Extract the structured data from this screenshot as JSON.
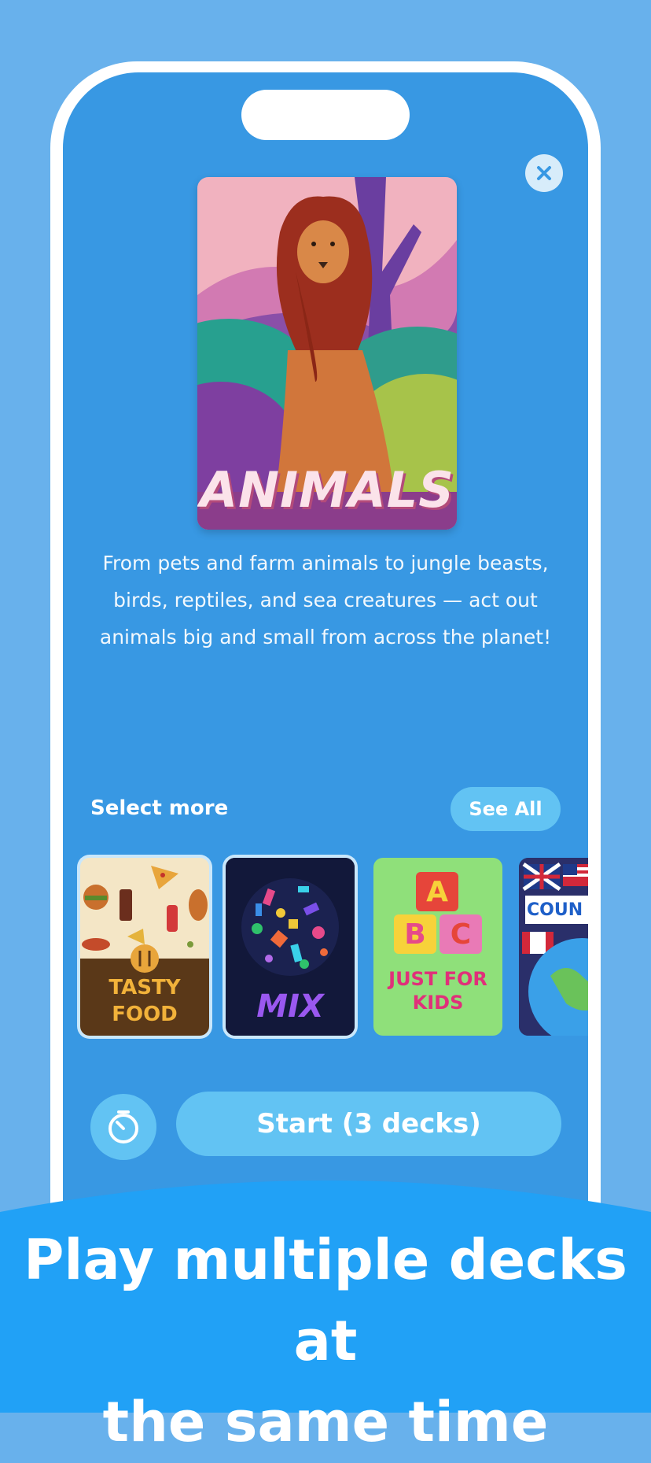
{
  "hero": {
    "deck_title": "ANIMALS",
    "description": "From pets and farm animals to jungle beasts, birds, reptiles, and sea creatures — act out animals big and small from across the planet!"
  },
  "select_more": {
    "label": "Select more",
    "see_all": "See All"
  },
  "decks": [
    {
      "title_line1": "TASTY",
      "title_line2": "FOOD",
      "selected": true
    },
    {
      "title": "MIX",
      "selected": true
    },
    {
      "title_line1": "JUST FOR",
      "title_line2": "KIDS",
      "block_letters": [
        "A",
        "B",
        "C"
      ],
      "selected": false
    },
    {
      "title": "COUN",
      "selected": false
    }
  ],
  "actions": {
    "start_label": "Start (3 decks)"
  },
  "banner": {
    "line1": "Play multiple decks at",
    "line2": "the same time"
  },
  "icons": {
    "close": "close-icon",
    "timer": "timer-icon"
  },
  "colors": {
    "background": "#68b1ec",
    "screen": "#3898e3",
    "accent_button": "#62c3f3",
    "banner": "#21a1f6"
  }
}
